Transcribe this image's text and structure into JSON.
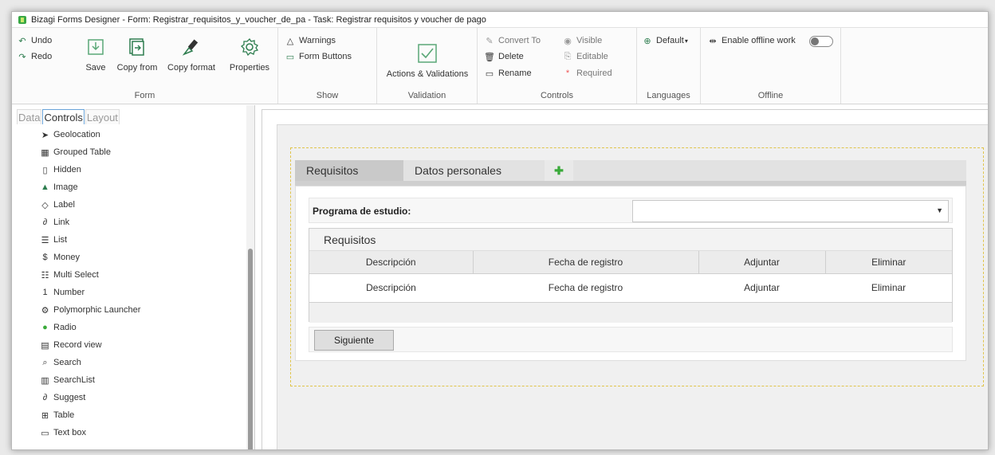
{
  "window": {
    "title": "Bizagi Forms Designer  - Form: Registrar_requisitos_y_voucher_de_pa - Task:  Registrar requisitos y voucher de pago"
  },
  "ribbon": {
    "form": {
      "label": "Form",
      "undo": "Undo",
      "redo": "Redo",
      "save": "Save",
      "copy_from": "Copy from",
      "copy_format": "Copy format",
      "properties": "Properties"
    },
    "show": {
      "label": "Show",
      "warnings": "Warnings",
      "form_buttons": "Form Buttons"
    },
    "validation": {
      "label": "Validation",
      "actions_validations": "Actions & Validations"
    },
    "controls": {
      "label": "Controls",
      "convert_to": "Convert To",
      "delete": "Delete",
      "rename": "Rename",
      "visible": "Visible",
      "editable": "Editable",
      "required": "Required"
    },
    "languages": {
      "label": "Languages",
      "default": "Default"
    },
    "offline": {
      "label": "Offline",
      "enable": "Enable offline work"
    }
  },
  "left_panel": {
    "tabs": [
      "Data",
      "Controls",
      "Layout"
    ],
    "active_tab": "Controls",
    "controls": [
      {
        "label": "Geolocation",
        "icon": "geolocation-icon"
      },
      {
        "label": "Grouped Table",
        "icon": "grouped-table-icon"
      },
      {
        "label": "Hidden",
        "icon": "hidden-icon"
      },
      {
        "label": "Image",
        "icon": "image-icon"
      },
      {
        "label": "Label",
        "icon": "label-icon"
      },
      {
        "label": "Link",
        "icon": "link-icon"
      },
      {
        "label": "List",
        "icon": "list-icon"
      },
      {
        "label": "Money",
        "icon": "money-icon"
      },
      {
        "label": "Multi Select",
        "icon": "multi-select-icon"
      },
      {
        "label": "Number",
        "icon": "number-icon"
      },
      {
        "label": "Polymorphic Launcher",
        "icon": "polymorphic-launcher-icon"
      },
      {
        "label": "Radio",
        "icon": "radio-icon"
      },
      {
        "label": "Record view",
        "icon": "record-view-icon"
      },
      {
        "label": "Search",
        "icon": "search-icon"
      },
      {
        "label": "SearchList",
        "icon": "searchlist-icon"
      },
      {
        "label": "Suggest",
        "icon": "suggest-icon"
      },
      {
        "label": "Table",
        "icon": "table-icon"
      },
      {
        "label": "Text box",
        "icon": "text-box-icon"
      }
    ]
  },
  "form": {
    "tabs": [
      "Requisitos",
      "Datos personales"
    ],
    "active_tab": "Requisitos",
    "field_label": "Programa de estudio:",
    "field_value": "",
    "grid": {
      "title": "Requisitos",
      "columns": [
        "Descripción",
        "Fecha de registro",
        "Adjuntar",
        "Eliminar"
      ],
      "rows": [
        [
          "Descripción",
          "Fecha de registro",
          "Adjuntar",
          "Eliminar"
        ]
      ]
    },
    "next_button": "Siguiente"
  },
  "colors": {
    "accent": "#2e7d4f",
    "plus": "#3aaa3a",
    "dotted_border": "#e0c44a"
  }
}
